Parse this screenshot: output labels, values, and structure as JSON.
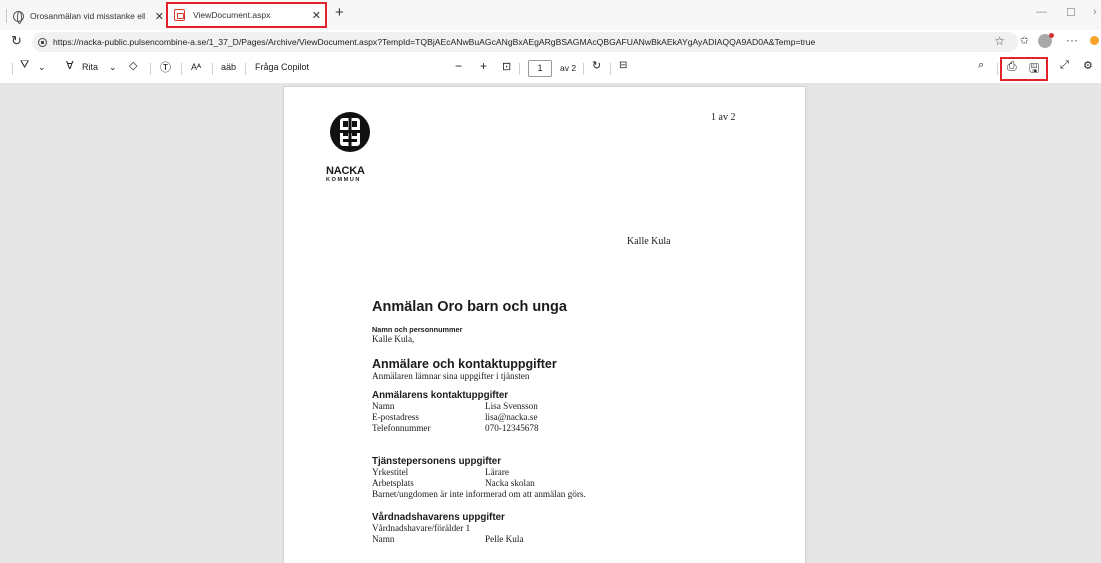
{
  "tabs": [
    {
      "title": "Orosanmälan vid misstanke eller"
    },
    {
      "title": "ViewDocument.aspx"
    }
  ],
  "address_bar": {
    "url": "https://nacka-public.pulsencombine-a.se/1_37_D/Pages/Archive/ViewDocument.aspx?TempId=TQBjAEcANwBuAGcANgBxAEgARgBSAGMAcQBGAFUANwBkAEkAYgAyADIAQQA9AD0A&Temp=true"
  },
  "pdf_toolbar": {
    "draw_label": "Rita",
    "read_aloud_label": "Aᴬ",
    "translate_label": "aäb",
    "copilot_label": "Fråga Copilot",
    "page_current": "1",
    "page_total": "av 2"
  },
  "document": {
    "logo_text": "NACKA",
    "logo_subtext": "KOMMUN",
    "page_indicator": "1 av 2",
    "addressee": "Kalle Kula",
    "title": "Anmälan Oro barn och unga",
    "name_label": "Namn och personnummer",
    "name_value": "Kalle Kula,",
    "reporter_heading": "Anmälare och kontaktuppgifter",
    "reporter_note": "Anmälaren lämnar sina uppgifter i tjänsten",
    "contact_heading": "Anmälarens kontaktuppgifter",
    "contact": [
      {
        "key": "Namn",
        "value": "Lisa Svensson"
      },
      {
        "key": "E-postadress",
        "value": "lisa@nacka.se"
      },
      {
        "key": "Telefonnummer",
        "value": "070-12345678"
      }
    ],
    "staff_heading": "Tjänstepersonens uppgifter",
    "staff": [
      {
        "key": "Yrkestitel",
        "value": "Lärare"
      },
      {
        "key": "Arbetsplats",
        "value": "Nacka skolan"
      }
    ],
    "staff_note": "Barnet/ungdomen är inte informerad om att anmälan görs.",
    "guardian_heading": "Vårdnadshavarens uppgifter",
    "guardian_label": "Vårdnadshavare/förälder 1",
    "guardian": [
      {
        "key": "Namn",
        "value": "Pelle Kula"
      }
    ]
  }
}
